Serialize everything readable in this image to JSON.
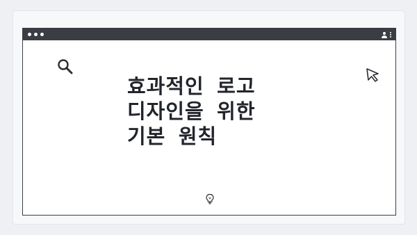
{
  "icons": {
    "window_controls": "traffic-light-dots",
    "account": "user-icon",
    "menu": "kebab-menu-icon",
    "search": "search-icon",
    "pointer": "cursor-icon",
    "idea": "lightbulb-icon"
  },
  "headline": {
    "line1": "효과적인 로고",
    "line2": "디자인을 위한",
    "line3": "기본 원칙"
  },
  "colors": {
    "titlebar": "#3a3d44",
    "text": "#22252b",
    "background": "#eef0f4"
  }
}
